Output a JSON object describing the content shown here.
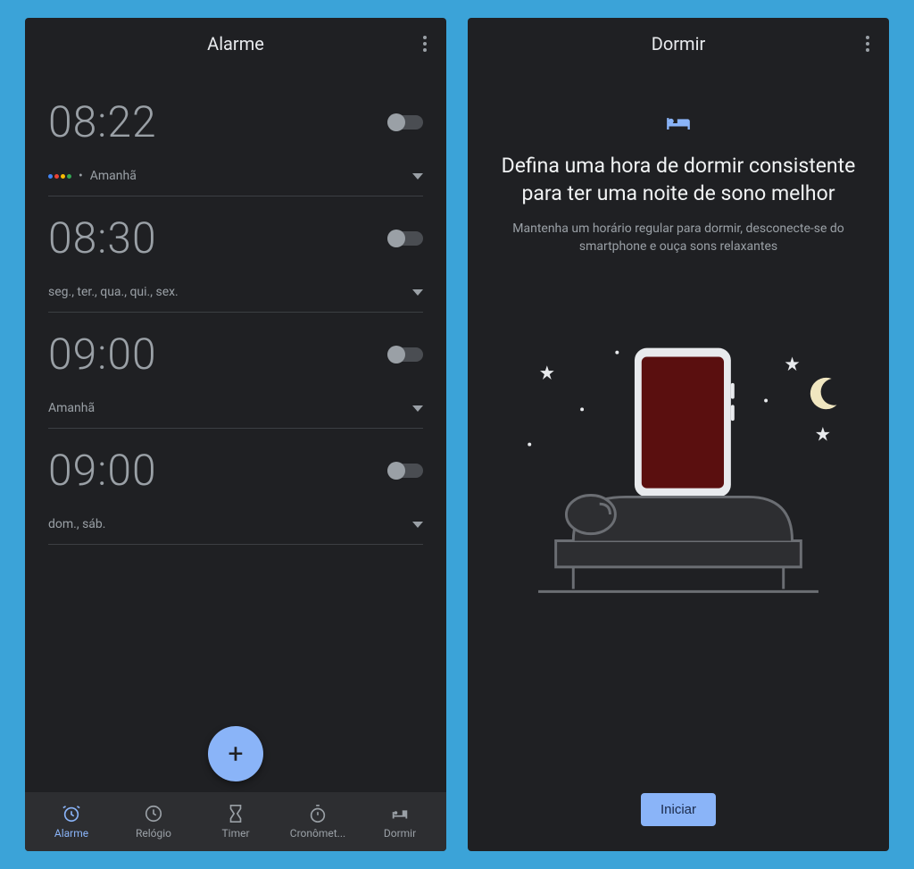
{
  "left": {
    "title": "Alarme",
    "alarms": [
      {
        "time": "08:22",
        "subtitle": "Amanhã",
        "assistant": true,
        "enabled": false
      },
      {
        "time": "08:30",
        "subtitle": "seg., ter., qua., qui., sex.",
        "assistant": false,
        "enabled": false
      },
      {
        "time": "09:00",
        "subtitle": "Amanhã",
        "assistant": false,
        "enabled": false
      },
      {
        "time": "09:00",
        "subtitle": "dom., sáb.",
        "assistant": false,
        "enabled": false
      }
    ],
    "fab_label": "+",
    "nav": [
      {
        "label": "Alarme",
        "active": true
      },
      {
        "label": "Relógio",
        "active": false
      },
      {
        "label": "Timer",
        "active": false
      },
      {
        "label": "Cronômet...",
        "active": false
      },
      {
        "label": "Dormir",
        "active": false
      }
    ]
  },
  "right": {
    "title": "Dormir",
    "headline": "Defina uma hora de dormir consistente para ter uma noite de sono melhor",
    "subtext": "Mantenha um horário regular para dormir, desconecte-se do smartphone e ouça sons relaxantes",
    "start_label": "Iniciar"
  }
}
